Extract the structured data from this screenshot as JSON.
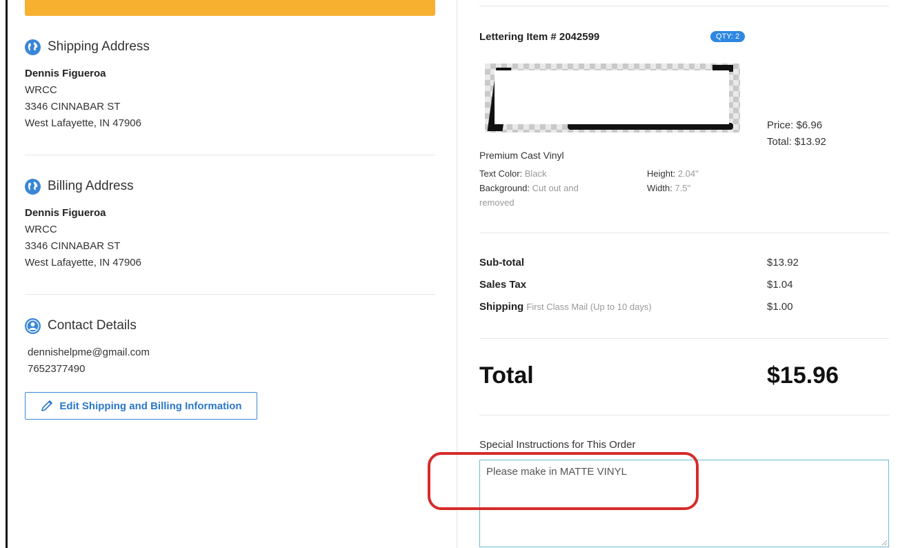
{
  "shipping": {
    "title": "Shipping Address",
    "name": "Dennis Figueroa",
    "line1": "WRCC",
    "line2": "3346 CINNABAR ST",
    "line3": "West Lafayette, IN 47906"
  },
  "billing": {
    "title": "Billing Address",
    "name": "Dennis Figueroa",
    "line1": "WRCC",
    "line2": "3346 CINNABAR ST",
    "line3": "West Lafayette, IN 47906"
  },
  "contact": {
    "title": "Contact Details",
    "email": "dennishelpme@gmail.com",
    "phone": "7652377490"
  },
  "edit_button": {
    "label": "Edit Shipping and Billing Information"
  },
  "item": {
    "title": "Lettering Item # 2042599",
    "qty": "QTY: 2",
    "price": "Price: $6.96",
    "total": "Total: $13.92",
    "material": "Premium Cast Vinyl",
    "text_color_label": "Text Color:",
    "text_color_value": "Black",
    "background_label": "Background:",
    "background_value_1": "Cut out and",
    "background_value_2": "removed",
    "height_label": "Height:",
    "height_value": "2.04\"",
    "width_label": "Width:",
    "width_value": "7.5\""
  },
  "summary": {
    "subtotal_label": "Sub-total",
    "subtotal_value": "$13.92",
    "tax_label": "Sales Tax",
    "tax_value": "$1.04",
    "shipping_label": "Shipping",
    "shipping_method": "First Class Mail (Up to 10 days)",
    "shipping_value": "$1.00",
    "total_label": "Total",
    "total_value": "$15.96"
  },
  "instructions": {
    "label": "Special Instructions for This Order",
    "value": "Please make in MATTE VINYL"
  },
  "colors": {
    "accent_bar": "#f7b030",
    "link_blue": "#2a78c8",
    "highlight_red": "#d82a2a"
  },
  "icons": {
    "shipping": "globe-icon",
    "billing": "globe-icon",
    "contact": "user-icon",
    "edit": "pencil-icon"
  }
}
